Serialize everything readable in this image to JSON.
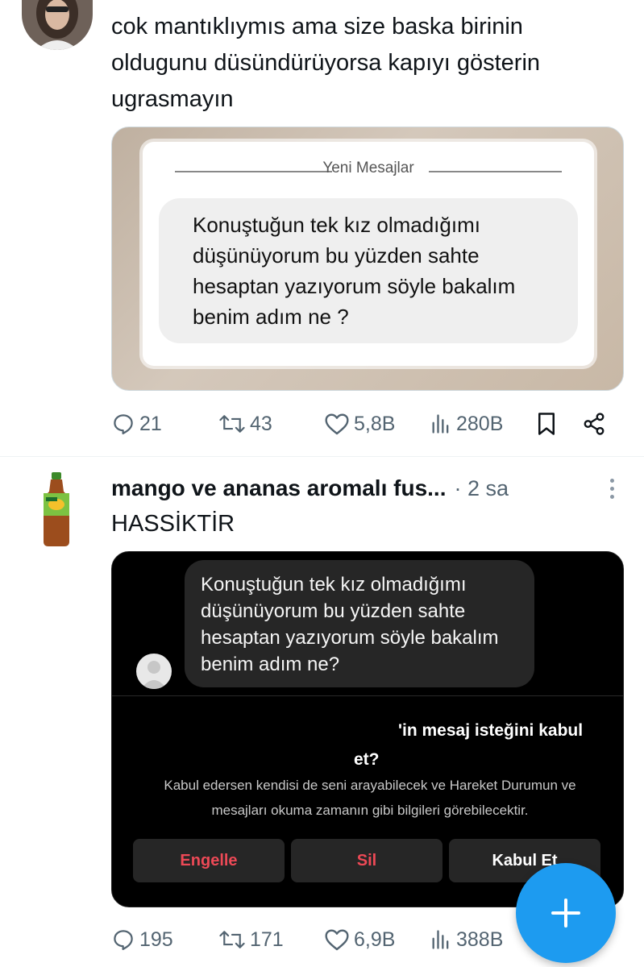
{
  "tweet1": {
    "text_lines": [
      "cok mantıklıymıs ama size baska birinin",
      "oldugunu düsündürüyorsa kapıyı gösterin",
      "ugrasmayın"
    ],
    "media": {
      "header": "Yeni Mesajlar",
      "message_lines": [
        "Konuştuğun tek kız olmadığımı",
        "düşünüyorum bu yüzden sahte",
        "hesaptan yazıyorum söyle bakalım",
        "benim adım ne ?"
      ]
    },
    "actions": {
      "replies": "21",
      "reposts": "43",
      "likes": "5,8B",
      "views": "280B"
    }
  },
  "tweet2": {
    "name": "mango ve ananas aromalı fus...",
    "time": "· 2 sa",
    "text": "HASSİKTİR",
    "media": {
      "message_lines": [
        "Konuştuğun tek kız olmadığımı",
        "düşünüyorum bu yüzden sahte",
        "hesaptan yazıyorum söyle bakalım",
        "benim adım ne?"
      ],
      "request_title_1": "'in mesaj isteğini kabul",
      "request_title_2": "et?",
      "request_sub_1": "Kabul edersen kendisi de seni arayabilecek ve Hareket Durumun ve",
      "request_sub_2": "mesajları okuma zamanın gibi bilgileri görebilecektir.",
      "btn_block": "Engelle",
      "btn_delete": "Sil",
      "btn_accept": "Kabul Et",
      "colors": {
        "block": "#ed4956",
        "delete": "#ed4956",
        "accept": "#ffffff"
      }
    },
    "actions": {
      "replies": "195",
      "reposts": "171",
      "likes": "6,9B",
      "views": "388B"
    }
  },
  "colors": {
    "accent": "#1d9bf0",
    "muted": "#536471",
    "text": "#0f1419"
  },
  "icons": [
    "reply-icon",
    "repost-icon",
    "like-icon",
    "views-icon",
    "bookmark-icon",
    "share-icon",
    "more-icon",
    "compose-icon"
  ]
}
